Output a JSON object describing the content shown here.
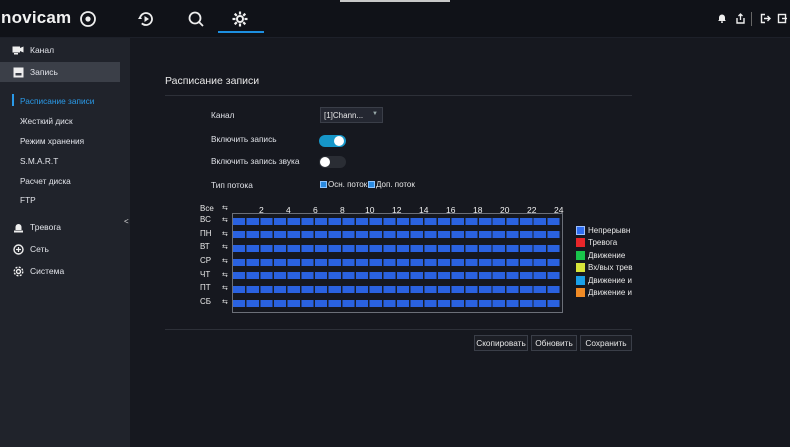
{
  "brand": {
    "logo": "novicam",
    "accent": "#1d8fe0"
  },
  "topnav": [
    {
      "name": "live-icon"
    },
    {
      "name": "playback-icon"
    },
    {
      "name": "search-icon"
    },
    {
      "name": "settings-icon",
      "active": true
    }
  ],
  "sidebar": {
    "items": [
      {
        "label": "Канал",
        "icon": "camera-icon"
      },
      {
        "label": "Запись",
        "icon": "record-icon",
        "active": true
      },
      {
        "label": "Тревога",
        "icon": "alarm-icon"
      },
      {
        "label": "Сеть",
        "icon": "network-icon"
      },
      {
        "label": "Система",
        "icon": "system-icon"
      }
    ],
    "subitems": [
      {
        "label": "Расписание записи",
        "active": true
      },
      {
        "label": "Жесткий диск"
      },
      {
        "label": "Режим хранения"
      },
      {
        "label": "S.M.A.R.T"
      },
      {
        "label": "Расчет диска"
      },
      {
        "label": "FTP"
      }
    ]
  },
  "content": {
    "title": "Расписание записи",
    "channel_label": "Канал",
    "channel_value": "[1]Chann...",
    "enable_record_label": "Включить запись",
    "enable_record_on": true,
    "enable_audio_label": "Включить запись звука",
    "enable_audio_on": false,
    "stream_type_label": "Тип потока",
    "main_stream": "Осн. поток",
    "sub_stream": "Доп. поток"
  },
  "schedule": {
    "all_label": "Все",
    "days": [
      "ВС",
      "ПН",
      "ВТ",
      "СР",
      "ЧТ",
      "ПТ",
      "СБ"
    ],
    "hours": [
      "2",
      "4",
      "6",
      "8",
      "10",
      "12",
      "14",
      "16",
      "18",
      "20",
      "22",
      "24"
    ],
    "fill_color": "#2a62e0"
  },
  "legend": [
    {
      "label": "Непрерывн",
      "color": "#2f6df0"
    },
    {
      "label": "Тревога",
      "color": "#e8262a"
    },
    {
      "label": "Движение",
      "color": "#19c44b"
    },
    {
      "label": "Вх/вых трев",
      "color": "#d7e53a"
    },
    {
      "label": "Движение и",
      "color": "#1aa0e8"
    },
    {
      "label": "Движение и",
      "color": "#f08b26"
    }
  ],
  "buttons": {
    "copy": "Скопировать",
    "refresh": "Обновить",
    "save": "Сохранить"
  }
}
